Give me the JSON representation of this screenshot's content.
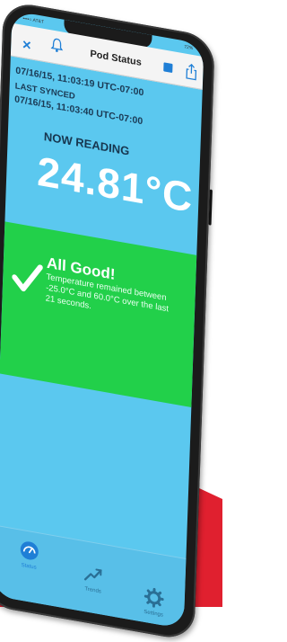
{
  "colors": {
    "background_red": "#e0202f",
    "screen_blue": "#5bc8ef",
    "status_green": "#22d04a",
    "accent_blue": "#1f7fd6"
  },
  "statusbar": {
    "carrier": "••••○ AT&T",
    "battery": "72%"
  },
  "navbar": {
    "title": "Pod Status",
    "close_icon": "x-icon",
    "bell_icon": "bell-icon",
    "stop_icon": "stop-icon",
    "share_icon": "share-icon"
  },
  "reading": {
    "timestamp": "07/16/15, 11:03:19 UTC-07:00",
    "last_synced_label": "LAST SYNCED",
    "last_synced_time": "07/16/15, 11:03:40 UTC-07:00",
    "now_reading_label": "NOW READING",
    "temperature": "24.81°C"
  },
  "status": {
    "icon": "checkmark-icon",
    "title": "All Good!",
    "message": "Temperature remained between -25.0°C and 60.0°C over the last 21 seconds."
  },
  "tabs": [
    {
      "label": "Status",
      "icon": "gauge-icon"
    },
    {
      "label": "Trends",
      "icon": "trend-icon"
    },
    {
      "label": "Settings",
      "icon": "gear-icon"
    }
  ]
}
